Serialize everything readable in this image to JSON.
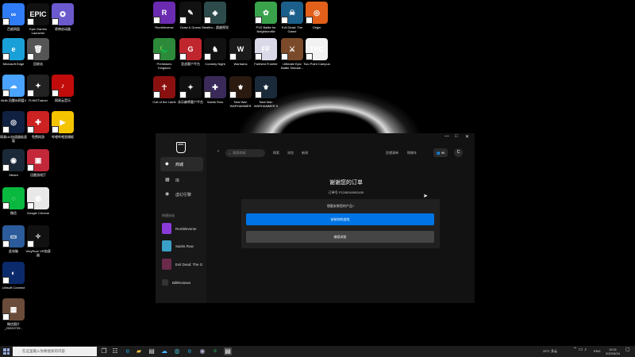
{
  "desktop": {
    "col1": [
      {
        "label": "百度网盘",
        "color": "#2f7cf6",
        "glyph": "∞"
      },
      {
        "label": "Microsoft Edge",
        "color": "#1aa0d8",
        "glyph": "e"
      },
      {
        "label": "Mulb 迅雷IB网盘4",
        "color": "#4aa3ff",
        "glyph": "☁"
      },
      {
        "label": "网易UU加速器极速版",
        "color": "#102040",
        "glyph": "◎"
      },
      {
        "label": "Steam",
        "color": "#1b2838",
        "glyph": "◉"
      },
      {
        "label": "微信",
        "color": "#09b83e",
        "glyph": "◌"
      },
      {
        "label": "此电脑",
        "color": "#2b5b9a",
        "glyph": "▭"
      },
      {
        "label": "Ubisoft Connect",
        "color": "#0a2a6b",
        "glyph": "◐"
      },
      {
        "label": "微信图片_20220729...",
        "color": "#6b4b3a",
        "glyph": "▦"
      }
    ],
    "col2": [
      {
        "label": "Epic Games Launcher",
        "color": "#111",
        "glyph": "EPIC"
      },
      {
        "label": "回收站",
        "color": "#555",
        "glyph": "🗑"
      },
      {
        "label": "FLiNGTrainer",
        "color": "#222",
        "glyph": "✦"
      },
      {
        "label": "免费网游",
        "color": "#c22",
        "glyph": "✚"
      },
      {
        "label": "迅雷游戏厅",
        "color": "#c2283a",
        "glyph": "▣"
      },
      {
        "label": "Google Chrome",
        "color": "#e8e8e8",
        "glyph": "◍"
      },
      {
        "label": "VeryRuer VR加速器",
        "color": "#111",
        "glyph": "✧"
      }
    ],
    "col3": [
      {
        "label": "原神启动器",
        "color": "#6a5acd",
        "glyph": "✪"
      },
      {
        "label": "网易云音乐",
        "color": "#c20c0c",
        "glyph": "♪"
      },
      {
        "label": "哔哩哔哩直播姬",
        "color": "#f5c400",
        "glyph": "▶"
      }
    ],
    "grid": [
      {
        "label": "Rumbleverse",
        "color": "#6a2bb0",
        "glyph": "R"
      },
      {
        "label": "Draw & Guess",
        "color": "#111",
        "glyph": "✎"
      },
      {
        "label": "Stealthc - 超越视觉",
        "color": "#2d4b4b",
        "glyph": "◈"
      },
      {
        "label": "PVZ Battle for Neighborville",
        "color": "#3aa24b",
        "glyph": "✿"
      },
      {
        "label": "Evil Dead: The Game",
        "color": "#1c5f8a",
        "glyph": "☠"
      },
      {
        "label": "Origin",
        "color": "#e2601a",
        "glyph": "◎"
      },
      {
        "label": "Prehistoric Kingdom",
        "color": "#2c8a3a",
        "glyph": "🦕"
      },
      {
        "label": "圣战客户平台",
        "color": "#c0262d",
        "glyph": "G"
      },
      {
        "label": "Comedy Night",
        "color": "#111",
        "glyph": "♞"
      },
      {
        "label": "Warhams",
        "color": "#1b1b1b",
        "glyph": "W"
      },
      {
        "label": "Farthest Frontier",
        "color": "#d9d9e8",
        "glyph": "FF"
      },
      {
        "label": "Ultimate Epic Battle Simulat...",
        "color": "#7a4a2a",
        "glyph": "⚔"
      },
      {
        "label": "Two Point Campus",
        "color": "#f2f2f2",
        "glyph": "TPC"
      },
      {
        "label": "Cult of the Lamb",
        "color": "#8a1010",
        "glyph": "☥"
      },
      {
        "label": "永乐麻将客户平台",
        "color": "#111",
        "glyph": "✦"
      },
      {
        "label": "Saints Row",
        "color": "#3a2a5a",
        "glyph": "✚"
      },
      {
        "label": "Total War: WARHAMMER",
        "color": "#2a1a10",
        "glyph": "⚜"
      },
      {
        "label": "Total War: WARHAMMER II",
        "color": "#1a2a3a",
        "glyph": "⚜"
      }
    ]
  },
  "window": {
    "logo": "EPIC",
    "nav": {
      "store": "商城",
      "library": "库",
      "unreal": "虚幻引擎"
    },
    "quick_title": "快速启动",
    "quick_items": [
      {
        "label": "Rumbleverse",
        "color": "#8a3ad8"
      },
      {
        "label": "Saints Row",
        "color": "#3aa0c8"
      },
      {
        "label": "Evil Dead: The G",
        "color": "#6a2a4a"
      }
    ],
    "quick_extra": "BiliReviews",
    "search_placeholder": "搜索商城",
    "top_tabs": [
      "探索",
      "浏览",
      "新闻"
    ],
    "top_right": [
      "愿望清单",
      "购物车"
    ],
    "friends_badge": "99",
    "avatar_letter": "C",
    "controls": [
      "—",
      "□",
      "✕"
    ],
    "order_title": "谢谢您的订单",
    "order_no": "订单号 F2208240952430",
    "dialog_question": "想要安装您的产品?",
    "btn_primary": "安装你的游戏",
    "btn_secondary": "继续浏览"
  },
  "taskbar": {
    "search_placeholder": "在这里输入你要搜索的内容",
    "weather": "25°C 多云",
    "lang": "ENG",
    "time": "19:31",
    "date": "2022/8/24"
  }
}
